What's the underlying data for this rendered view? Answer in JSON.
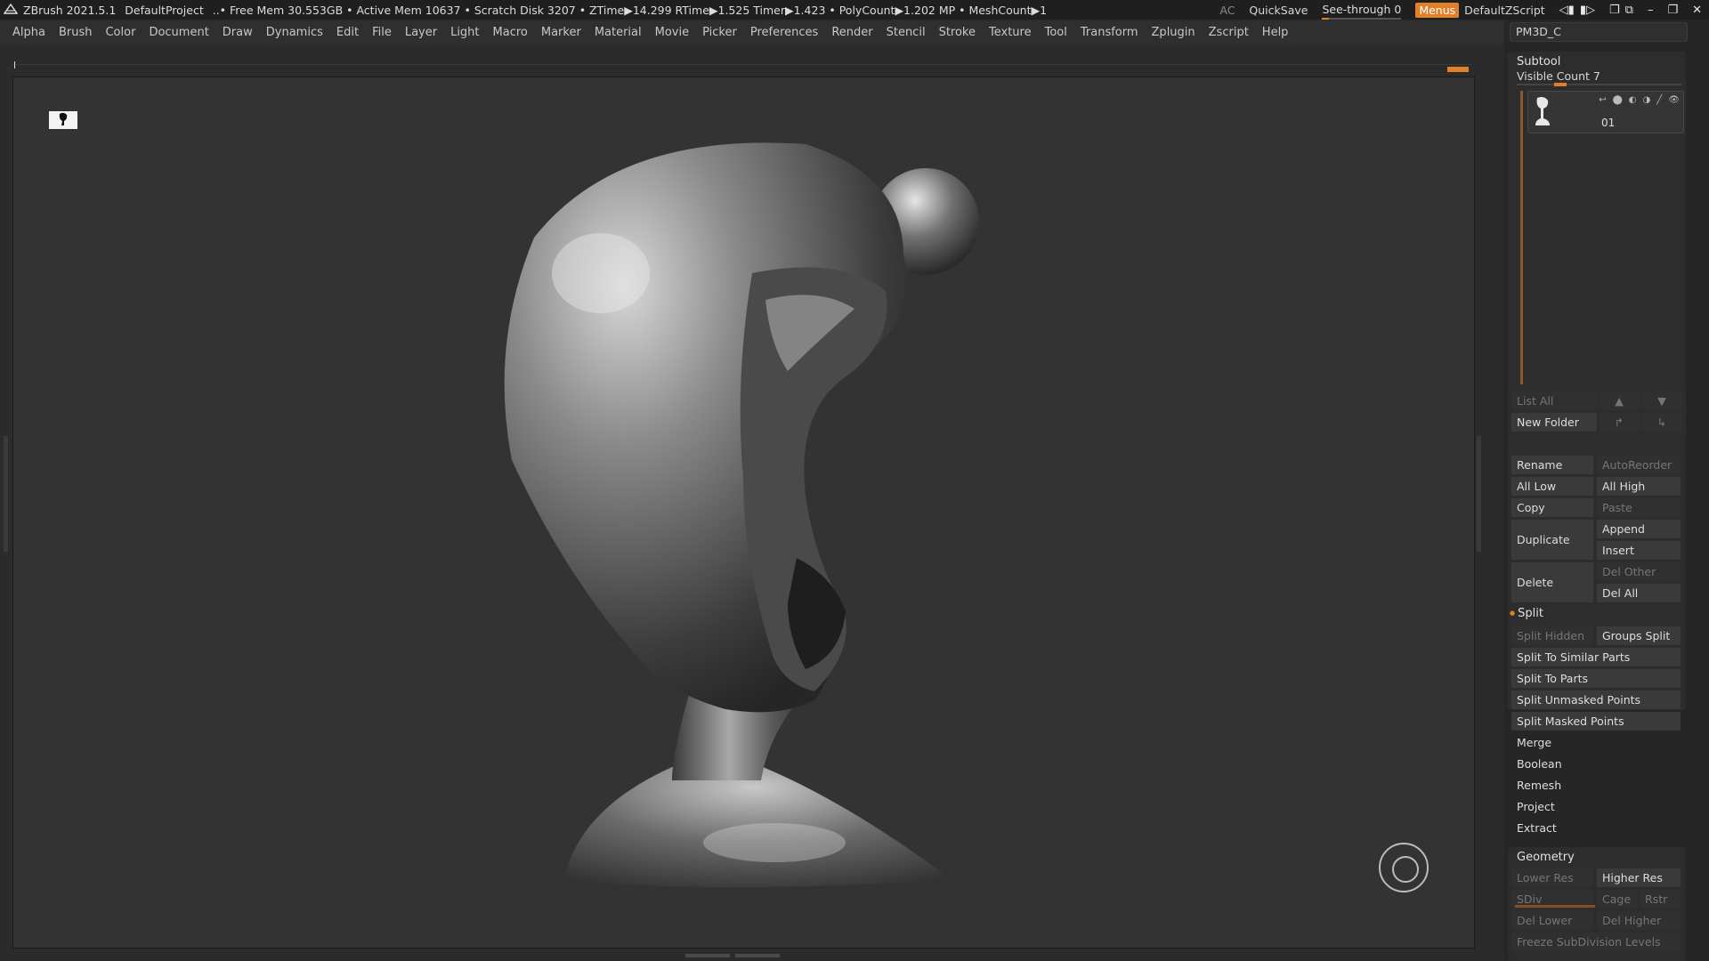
{
  "titlebar": {
    "app": "ZBrush 2021.5.1",
    "project": "DefaultProject",
    "stats": "..• Free Mem 30.553GB • Active Mem 10637 • Scratch Disk 3207 • ZTime▶14.299 RTime▶1.525 Timer▶1.423 • PolyCount▶1.202 MP • MeshCount▶1",
    "ac": "AC",
    "quicksave": "QuickSave",
    "seethrough": "See-through  0",
    "menus": "Menus",
    "script": "DefaultZScript"
  },
  "menubar": [
    "Alpha",
    "Brush",
    "Color",
    "Document",
    "Draw",
    "Dynamics",
    "Edit",
    "File",
    "Layer",
    "Light",
    "Macro",
    "Marker",
    "Material",
    "Movie",
    "Picker",
    "Preferences",
    "Render",
    "Stencil",
    "Stroke",
    "Texture",
    "Tool",
    "Transform",
    "Zplugin",
    "Zscript",
    "Help"
  ],
  "panel": {
    "tool_name": "PM3D_C",
    "subtool_header": "Subtool",
    "visible_count": "Visible Count 7",
    "subtool_item": "01",
    "list_all": "List All",
    "new_folder": "New Folder",
    "rename": "Rename",
    "autoreorder": "AutoReorder",
    "all_low": "All Low",
    "all_high": "All High",
    "copy": "Copy",
    "paste": "Paste",
    "duplicate": "Duplicate",
    "append": "Append",
    "insert": "Insert",
    "delete": "Delete",
    "del_other": "Del Other",
    "del_all": "Del All",
    "split": "Split",
    "split_hidden": "Split Hidden",
    "groups_split": "Groups Split",
    "split_similar": "Split To Similar Parts",
    "split_parts": "Split To Parts",
    "split_unmasked": "Split Unmasked Points",
    "split_masked": "Split Masked Points",
    "merge": "Merge",
    "boolean": "Boolean",
    "remesh": "Remesh",
    "project": "Project",
    "extract": "Extract",
    "geometry_header": "Geometry",
    "lower_res": "Lower Res",
    "higher_res": "Higher Res",
    "sdiv": "SDiv",
    "cage": "Cage",
    "rstr": "Rstr",
    "del_lower": "Del Lower",
    "del_higher": "Del Higher",
    "freeze": "Freeze SubDivision Levels"
  },
  "colors": {
    "accent": "#e0802a",
    "bg": "#2b2b2b",
    "canvas": "#333333"
  }
}
